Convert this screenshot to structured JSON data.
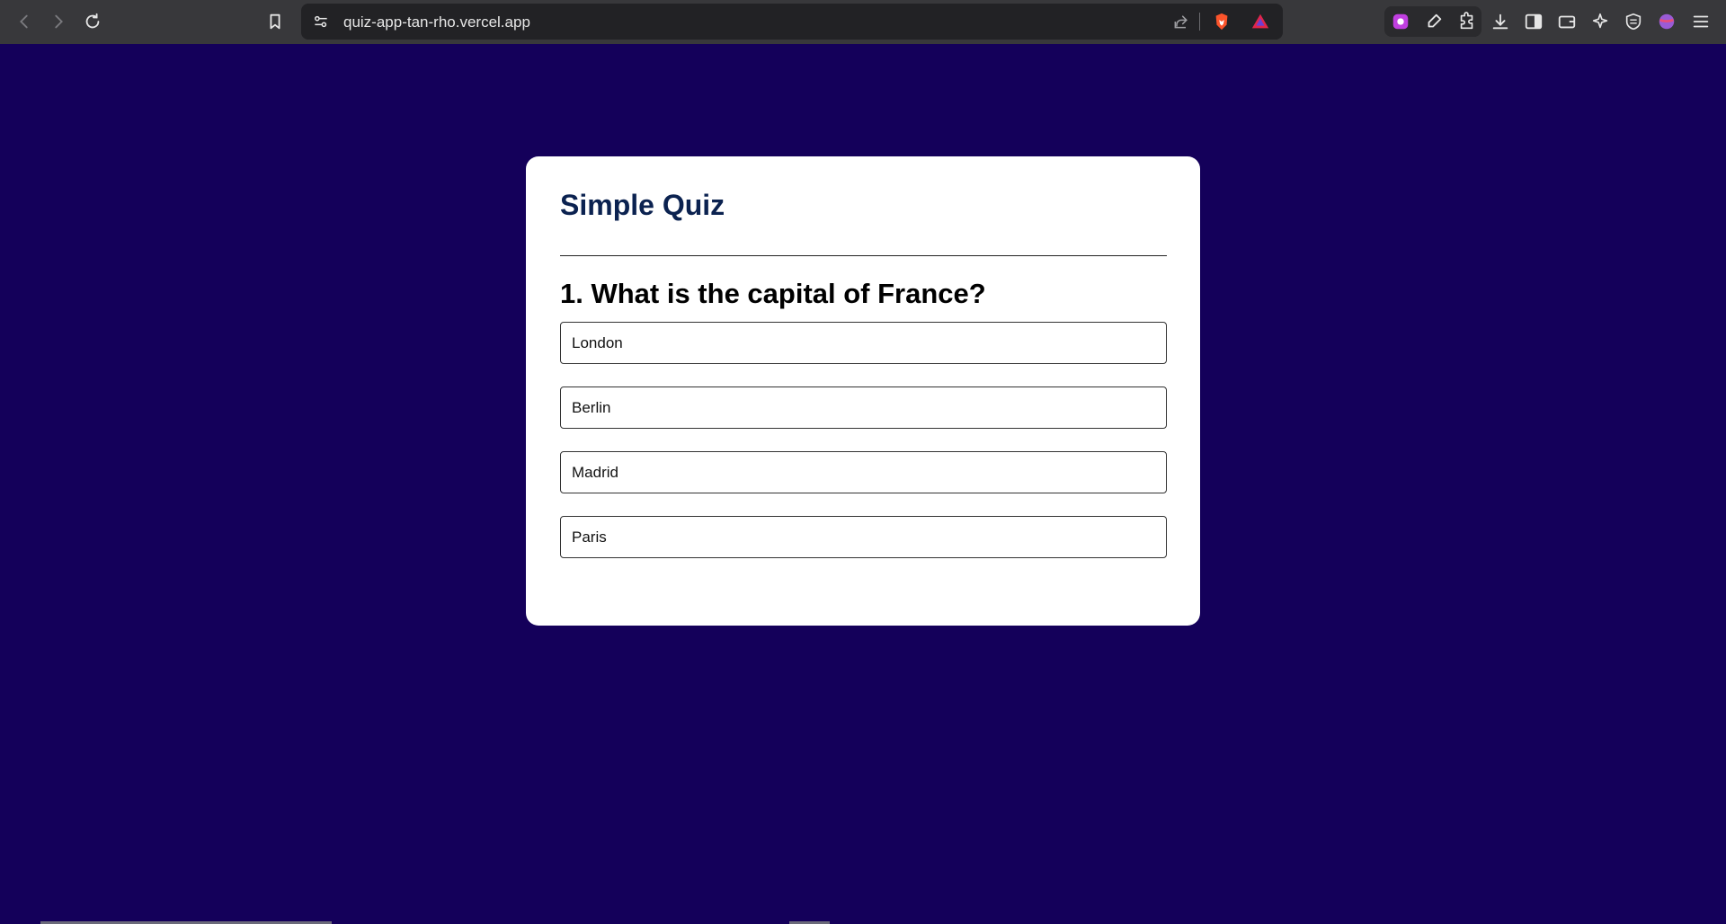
{
  "browser": {
    "url": "quiz-app-tan-rho.vercel.app",
    "icons": [
      "back-icon",
      "forward-icon",
      "reload-icon",
      "bookmark-icon",
      "site-settings-icon",
      "share-icon",
      "brave-shields-icon",
      "brave-rewards-icon",
      "leo-icon",
      "eyedropper-icon",
      "extensions-icon",
      "download-icon",
      "sidebar-icon",
      "wallet-icon",
      "ai-sparkle-icon",
      "vpn-icon",
      "profile-icon",
      "menu-icon"
    ]
  },
  "quiz": {
    "title": "Simple Quiz",
    "question": "1. What is the capital of France?",
    "answers": [
      "London",
      "Berlin",
      "Madrid",
      "Paris"
    ]
  },
  "colors": {
    "page_bg": "#14005a",
    "card_bg": "#ffffff",
    "title": "#0b2250"
  }
}
